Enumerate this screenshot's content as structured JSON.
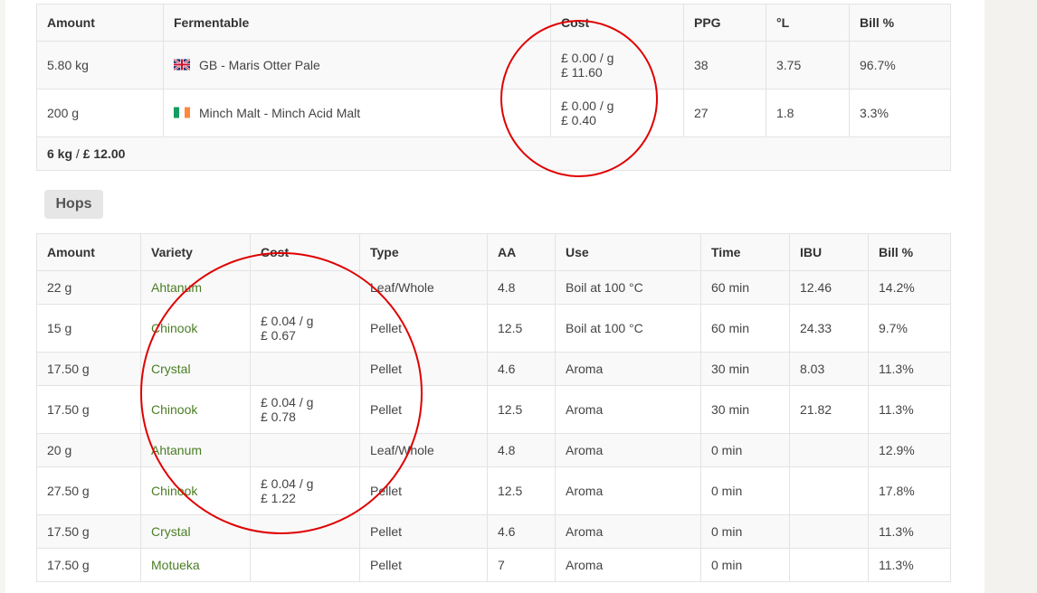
{
  "fermentables": {
    "headers": [
      "Amount",
      "Fermentable",
      "Cost",
      "PPG",
      "°L",
      "Bill %"
    ],
    "rows": [
      {
        "amount": "5.80 kg",
        "flag": "uk-flag-icon",
        "name": "GB - Maris Otter Pale",
        "cost_unit": "£ 0.00 / g",
        "cost_total": "£ 11.60",
        "ppg": "38",
        "lovibond": "3.75",
        "bill": "96.7%"
      },
      {
        "amount": "200 g",
        "flag": "ireland-flag-icon",
        "name": "Minch Malt - Minch Acid Malt",
        "cost_unit": "£ 0.00 / g",
        "cost_total": "£ 0.40",
        "ppg": "27",
        "lovibond": "1.8",
        "bill": "3.3%"
      }
    ],
    "total_weight": "6 kg",
    "total_separator": " / ",
    "total_cost": "£ 12.00"
  },
  "hops": {
    "section_label": "Hops",
    "headers": [
      "Amount",
      "Variety",
      "Cost",
      "Type",
      "AA",
      "Use",
      "Time",
      "IBU",
      "Bill %"
    ],
    "rows": [
      {
        "amount": "22 g",
        "variety": "Ahtanum",
        "cost_unit": "",
        "cost_total": "",
        "type": "Leaf/Whole",
        "aa": "4.8",
        "use": "Boil at 100 °C",
        "time": "60 min",
        "ibu": "12.46",
        "bill": "14.2%"
      },
      {
        "amount": "15 g",
        "variety": "Chinook",
        "cost_unit": "£ 0.04 / g",
        "cost_total": "£ 0.67",
        "type": "Pellet",
        "aa": "12.5",
        "use": "Boil at 100 °C",
        "time": "60 min",
        "ibu": "24.33",
        "bill": "9.7%"
      },
      {
        "amount": "17.50 g",
        "variety": "Crystal",
        "cost_unit": "",
        "cost_total": "",
        "type": "Pellet",
        "aa": "4.6",
        "use": "Aroma",
        "time": "30 min",
        "ibu": "8.03",
        "bill": "11.3%"
      },
      {
        "amount": "17.50 g",
        "variety": "Chinook",
        "cost_unit": "£ 0.04 / g",
        "cost_total": "£ 0.78",
        "type": "Pellet",
        "aa": "12.5",
        "use": "Aroma",
        "time": "30 min",
        "ibu": "21.82",
        "bill": "11.3%"
      },
      {
        "amount": "20 g",
        "variety": "Ahtanum",
        "cost_unit": "",
        "cost_total": "",
        "type": "Leaf/Whole",
        "aa": "4.8",
        "use": "Aroma",
        "time": "0 min",
        "ibu": "",
        "bill": "12.9%"
      },
      {
        "amount": "27.50 g",
        "variety": "Chinook",
        "cost_unit": "£ 0.04 / g",
        "cost_total": "£ 1.22",
        "type": "Pellet",
        "aa": "12.5",
        "use": "Aroma",
        "time": "0 min",
        "ibu": "",
        "bill": "17.8%"
      },
      {
        "amount": "17.50 g",
        "variety": "Crystal",
        "cost_unit": "",
        "cost_total": "",
        "type": "Pellet",
        "aa": "4.6",
        "use": "Aroma",
        "time": "0 min",
        "ibu": "",
        "bill": "11.3%"
      },
      {
        "amount": "17.50 g",
        "variety": "Motueka",
        "cost_unit": "",
        "cost_total": "",
        "type": "Pellet",
        "aa": "7",
        "use": "Aroma",
        "time": "0 min",
        "ibu": "",
        "bill": "11.3%"
      }
    ]
  },
  "colors": {
    "link": "#4a7d25",
    "annotation": "#e00000"
  }
}
